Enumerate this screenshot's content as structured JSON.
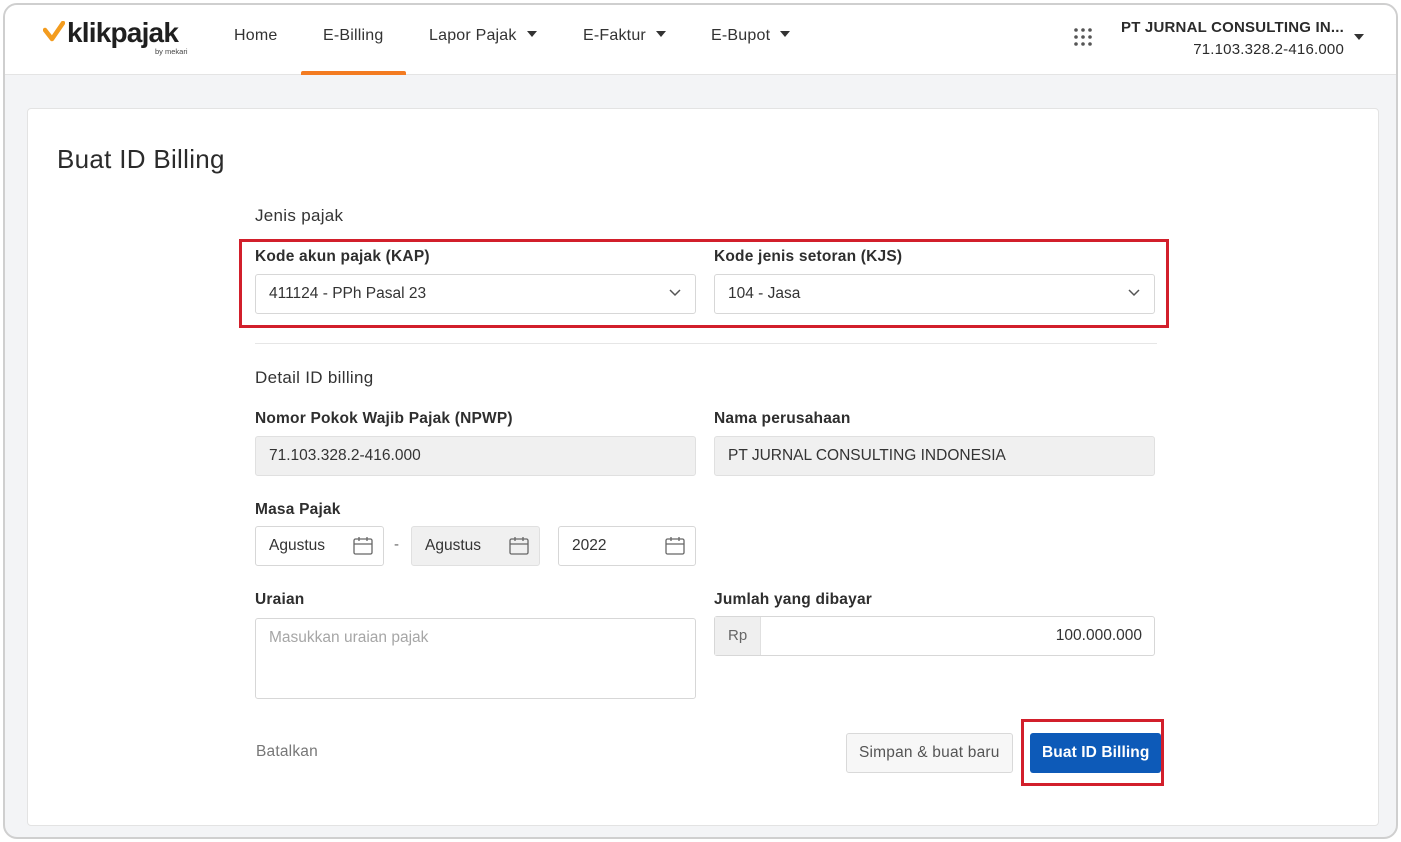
{
  "brand": {
    "name": "klikpajak",
    "byline": "by mekari",
    "accent": "#f37b21",
    "primary": "#0d5ab8",
    "highlight": "#d21f2b"
  },
  "nav": {
    "items": [
      {
        "label": "Home",
        "active": false,
        "dropdown": false
      },
      {
        "label": "E-Billing",
        "active": true,
        "dropdown": false
      },
      {
        "label": "Lapor Pajak",
        "active": false,
        "dropdown": true
      },
      {
        "label": "E-Faktur",
        "active": false,
        "dropdown": true
      },
      {
        "label": "E-Bupot",
        "active": false,
        "dropdown": true
      }
    ],
    "apps_icon": "grid-icon"
  },
  "account": {
    "company": "PT JURNAL CONSULTING IN...",
    "npwp": "71.103.328.2-416.000"
  },
  "page": {
    "title": "Buat ID Billing"
  },
  "jenis_pajak": {
    "section_title": "Jenis pajak",
    "kap_label": "Kode akun pajak (KAP)",
    "kap_value": "411124 - PPh Pasal 23",
    "kjs_label": "Kode jenis setoran (KJS)",
    "kjs_value": "104 - Jasa"
  },
  "detail": {
    "section_title": "Detail ID billing",
    "npwp_label": "Nomor Pokok Wajib Pajak (NPWP)",
    "npwp_value": "71.103.328.2-416.000",
    "company_label": "Nama perusahaan",
    "company_value": "PT JURNAL CONSULTING INDONESIA",
    "masa_label": "Masa Pajak",
    "masa_start": "Agustus",
    "masa_separator": "-",
    "masa_end": "Agustus",
    "year": "2022",
    "uraian_label": "Uraian",
    "uraian_placeholder": "Masukkan uraian pajak",
    "jumlah_label": "Jumlah yang dibayar",
    "currency": "Rp",
    "jumlah_value": "100.000.000"
  },
  "actions": {
    "cancel": "Batalkan",
    "save_new": "Simpan & buat baru",
    "submit": "Buat ID Billing"
  }
}
